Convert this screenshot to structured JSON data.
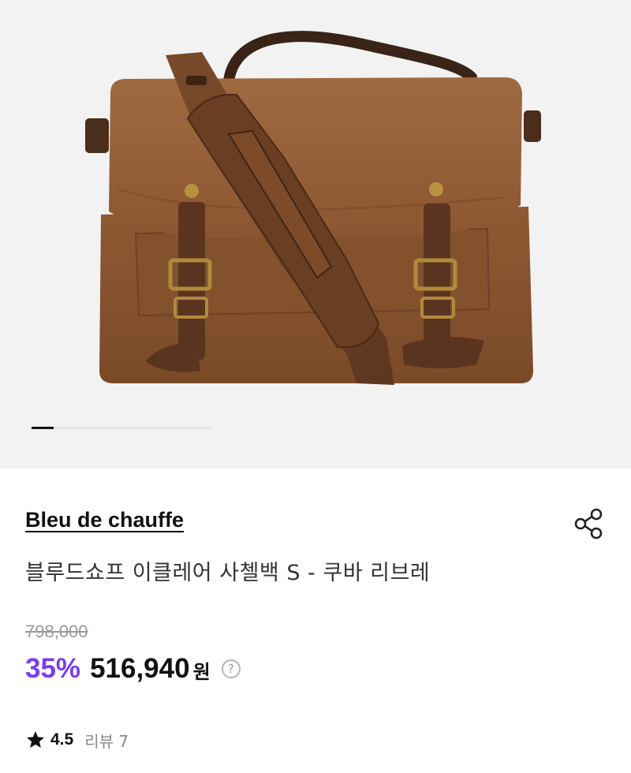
{
  "product": {
    "image_alt": "Bleu de chauffe brown leather satchel",
    "gallery_indicator": {
      "current": 1,
      "total": 8
    },
    "brand": "Bleu de chauffe",
    "name": "블루드쇼프 이클레어 사첼백 S - 쿠바 리브레",
    "original_price": "798,000",
    "discount_rate": "35%",
    "sale_price": "516,940",
    "currency": "원",
    "price_help_glyph": "?",
    "rating": "4.5",
    "review_label": "리뷰 7"
  },
  "icons": {
    "share": "share-icon",
    "star": "star-icon",
    "help": "question-circle-icon"
  },
  "colors": {
    "discount": "#7a3cf0",
    "background_gallery": "#f2f2f2",
    "text_primary": "#111111",
    "text_muted": "#9a9a9a"
  }
}
